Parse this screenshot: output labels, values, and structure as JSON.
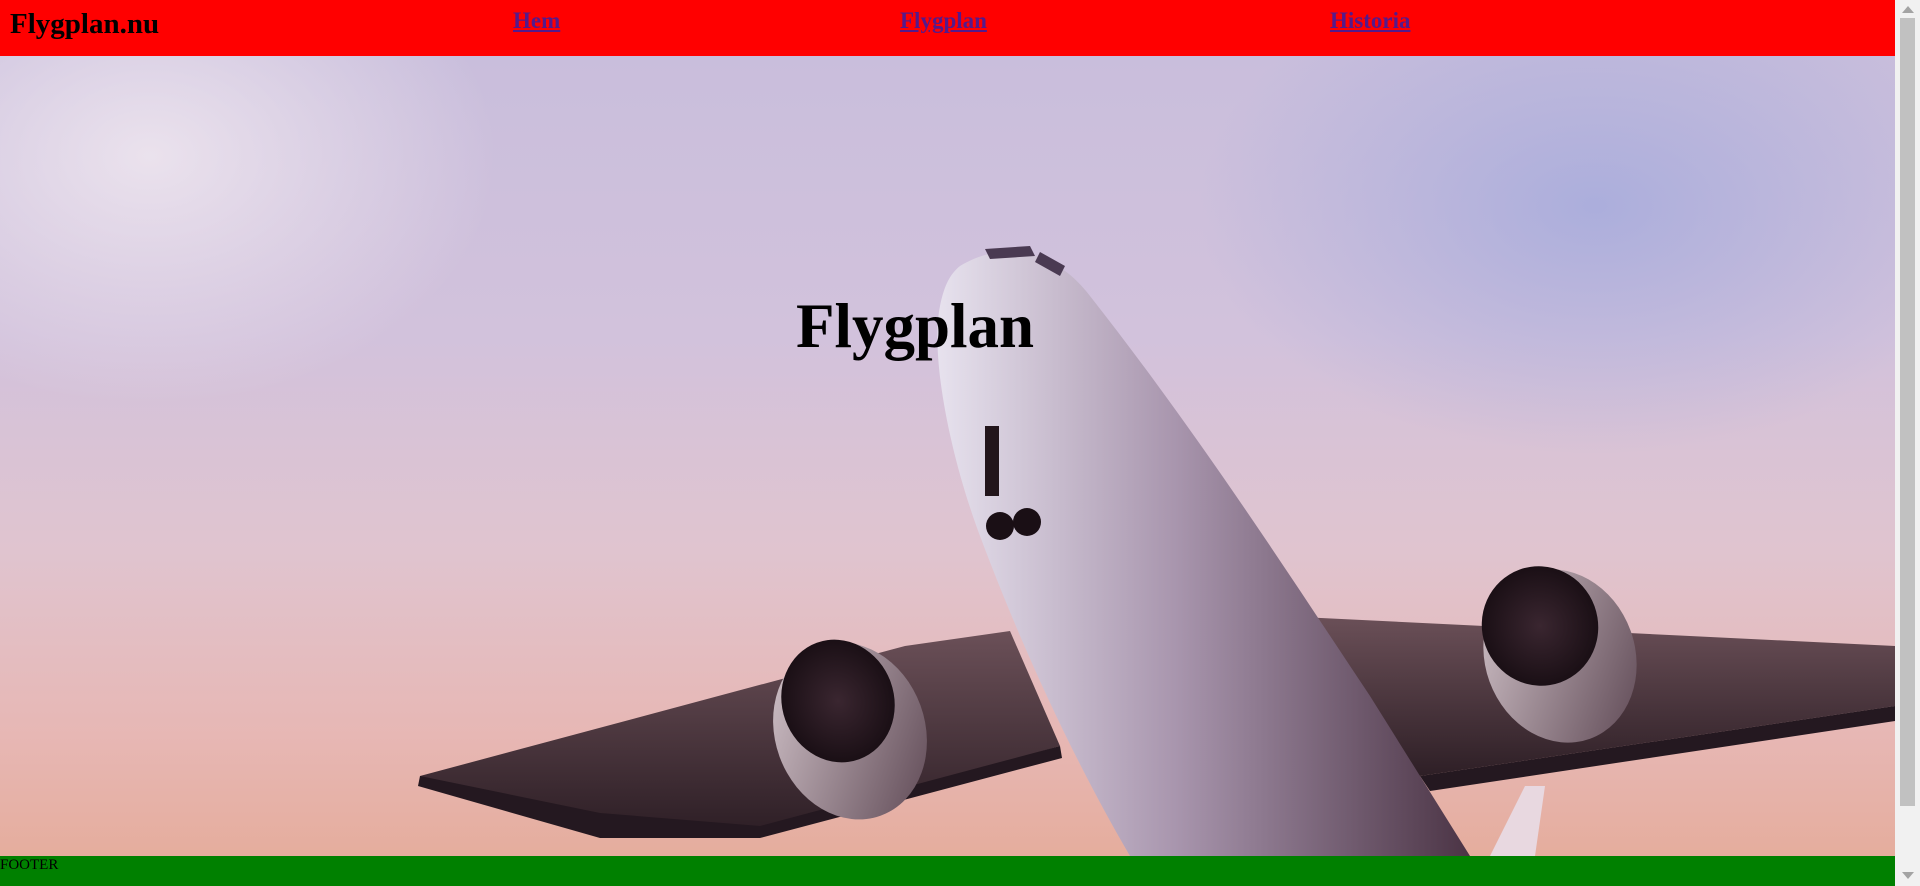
{
  "header": {
    "logo": "Flygplan.nu",
    "nav": [
      {
        "label": "Hem"
      },
      {
        "label": "Flygplan"
      },
      {
        "label": "Historia"
      }
    ],
    "background_color": "#ff0000",
    "link_color": "#551a8b"
  },
  "hero": {
    "title": "Flygplan",
    "image": "airplane-takeoff-photo"
  },
  "footer": {
    "text": "FOOTER",
    "background_color": "#008000"
  }
}
